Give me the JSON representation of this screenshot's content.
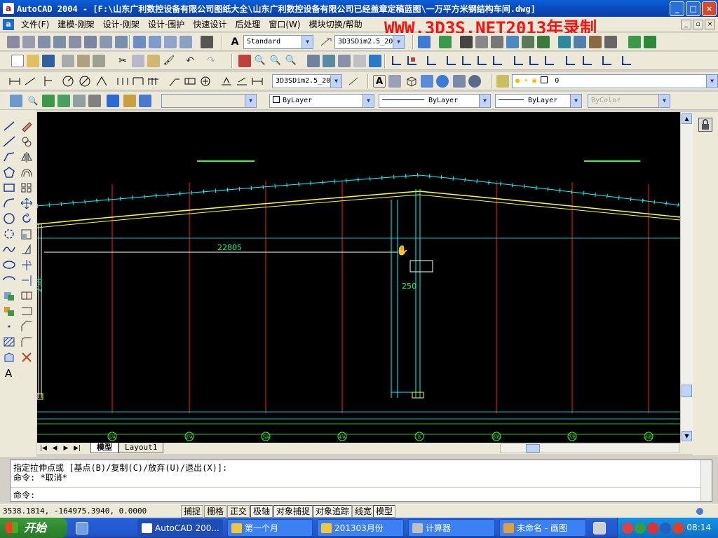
{
  "window": {
    "app_icon": "a",
    "title": "AutoCAD 2004 - [F:\\山东广利数控设备有限公司图纸大全\\山东广利数控设备有限公司已经盖章定稿蓝图\\一万平方米钢结构车间.dwg]",
    "minimize": "_",
    "maximize": "□",
    "close": "×"
  },
  "menu": {
    "items": [
      "文件(F)",
      "建模-刚架",
      "设计-刚架",
      "设计-围护",
      "快速设计",
      "后处理",
      "窗口(W)",
      "模块切换/帮助"
    ],
    "watermark": "WWW.3D3S.NET2013年录制"
  },
  "toolbars": {
    "text_style": "Standard",
    "dim_style_1": "3D3SDim2.5_20",
    "dim_style_2": "3D3SDim2.5_20",
    "layer": "0",
    "color": "ByLayer",
    "linetype": "ByLayer",
    "lineweight": "ByLayer",
    "plotstyle": "ByColor"
  },
  "drawing": {
    "dimension_text": "22805",
    "dim_250_a": "250",
    "dim_250_b": "250",
    "axis_labels": [
      "1/A",
      "2/A",
      "3/A",
      "4/A",
      "5/A",
      "B",
      "6/B",
      "7/B",
      "8/B"
    ]
  },
  "layout_tabs": {
    "tabs": [
      "模型",
      "Layout1"
    ]
  },
  "command": {
    "line1": "指定拉伸点或 [基点(B)/复制(C)/放弃(U)/退出(X)]:",
    "line2": "命令: *取消*",
    "prompt": "命令:"
  },
  "status": {
    "coords": "3538.1814, -164975.3940, 0.0000",
    "modes": [
      "捕捉",
      "栅格",
      "正交",
      "极轴",
      "对象捕捉",
      "对象追踪",
      "线宽",
      "模型"
    ]
  },
  "taskbar": {
    "start": "开始",
    "tasks": [
      "AutoCAD 200...",
      "第一个月",
      "201303月份",
      "计算器",
      "未命名 - 画图"
    ],
    "clock": "08:14"
  },
  "colors": {
    "titlebar": "#0a5fd8",
    "drawing_bg": "#000000",
    "axis_red": "#ff2020",
    "roof_yellow": "#ffff30",
    "cyan": "#00ffff",
    "green": "#30ff30",
    "watermark_red": "#ff1010"
  }
}
